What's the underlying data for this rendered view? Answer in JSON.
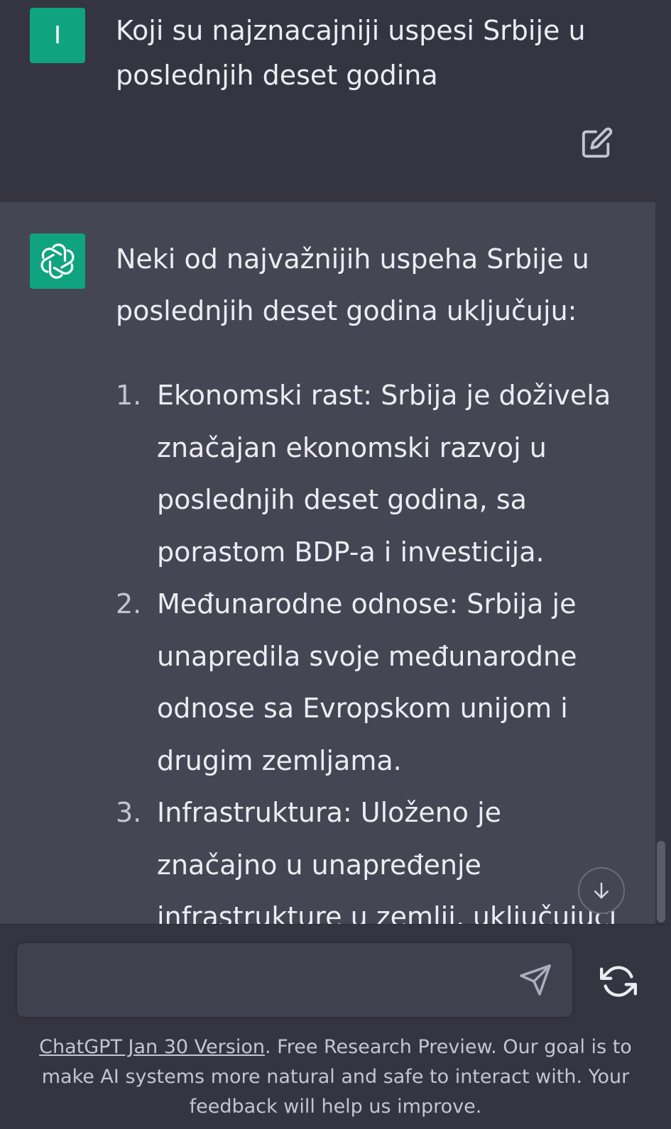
{
  "user_message": {
    "avatar_letter": "I",
    "text": "Koji su najznacajniji uspesi Srbije u poslednjih deset godina",
    "edit_icon": "edit-icon"
  },
  "assistant_message": {
    "intro": "Neki od najvažnijih uspeha Srbije u poslednjih deset godina uključuju:",
    "items": [
      {
        "number": "1.",
        "text": "Ekonomski rast: Srbija je doživela značajan ekonomski razvoj u poslednjih deset godina, sa porastom BDP-a i investicija."
      },
      {
        "number": "2.",
        "text": "Međunarodne odnose: Srbija je unapredila svoje međunarodne odnose sa Evropskom unijom i drugim zemljama."
      },
      {
        "number": "3.",
        "text": "Infrastruktura: Uloženo je značajno u unapređenje infrastrukture u zemlji, uključujući"
      }
    ]
  },
  "input": {
    "value": "",
    "placeholder": ""
  },
  "icons": {
    "send": "send-icon",
    "regenerate": "regenerate-icon",
    "scroll_down": "arrow-down-icon",
    "openai_logo": "openai-logo-icon"
  },
  "footer": {
    "link_text": "ChatGPT Jan 30 Version",
    "text": ". Free Research Preview. Our goal is to make AI systems more natural and safe to interact with. Your feedback will help us improve."
  },
  "colors": {
    "user_bg": "#343541",
    "assistant_bg": "#444654",
    "accent": "#10a37f",
    "text": "#ececf1"
  }
}
